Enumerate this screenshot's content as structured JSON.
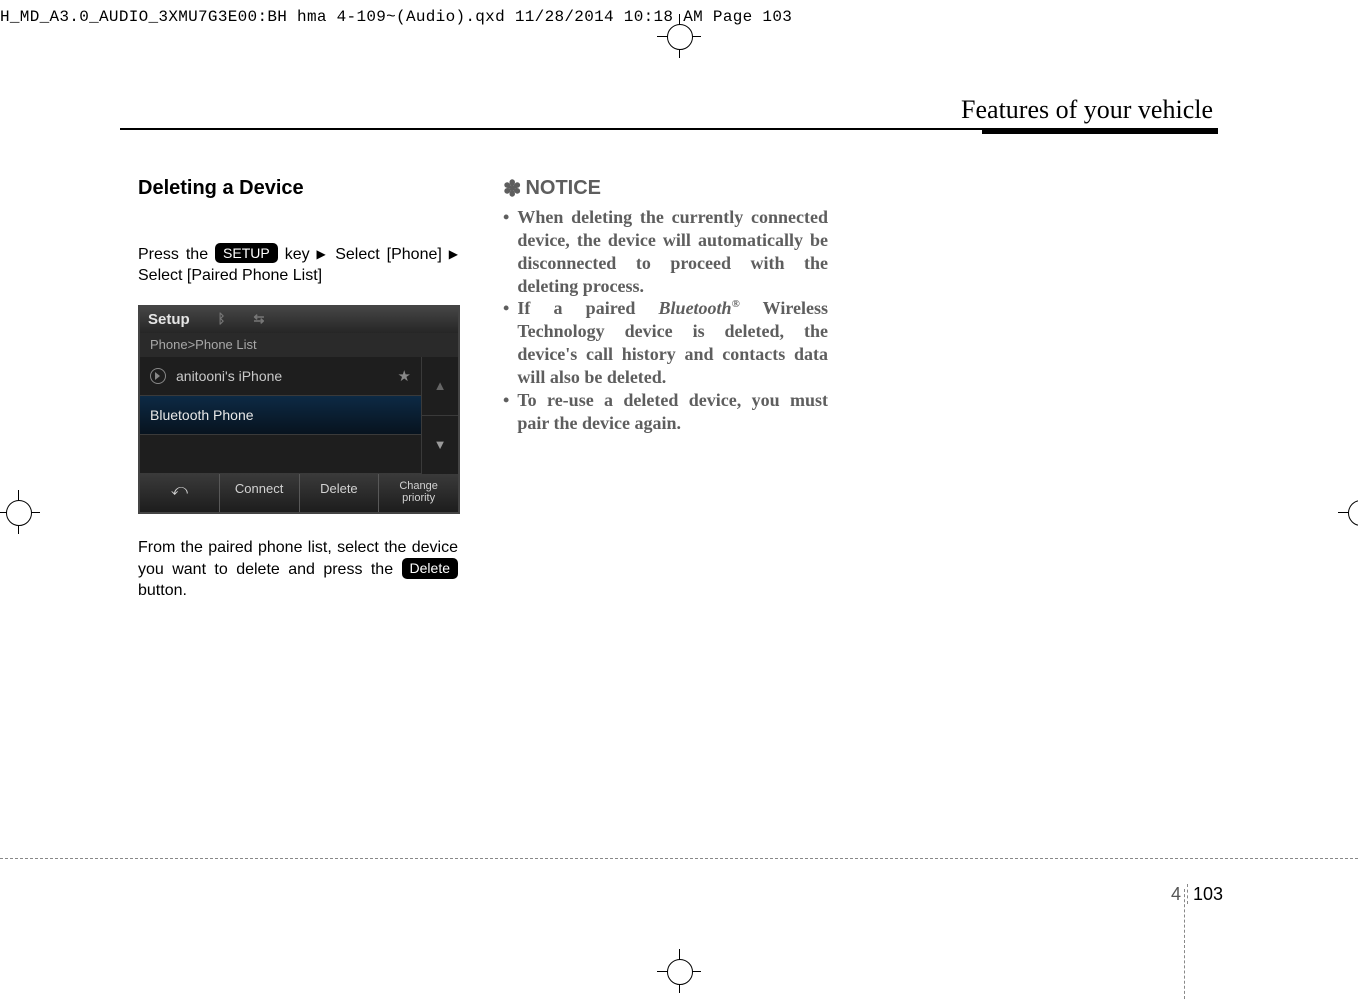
{
  "header_file_line": "H_MD_A3.0_AUDIO_3XMU7G3E00:BH hma 4-109~(Audio).qxd  11/28/2014  10:18 AM  Page 103",
  "running_head": "Features of your vehicle",
  "left": {
    "title": "Deleting a Device",
    "p1_a": "Press  the ",
    "setup_chip": "SETUP",
    "p1_b": " key",
    "p1_c": "Select [Phone] ",
    "p1_d": "Select [Paired Phone List]",
    "p2_a": "From the paired phone list, select the device you want to delete and press the ",
    "delete_chip": "Delete",
    "p2_b": " button."
  },
  "shot": {
    "bar_title": "Setup",
    "crumb": "Phone>Phone List",
    "row1": "anitooni's iPhone",
    "row2": "Bluetooth Phone",
    "footer_connect": "Connect",
    "footer_delete": "Delete",
    "footer_change1": "Change",
    "footer_change2": "priority"
  },
  "notice": {
    "title": "NOTICE",
    "item1": "When deleting the currently connected device, the device will automatically be disconnected to proceed with the deleting process.",
    "item2_a": "If a paired ",
    "item2_bt": "Bluetooth",
    "item2_b": "  Wireless Technology device is deleted, the device's call history and contacts data will also be deleted.",
    "item3": "To re-use a deleted device, you must pair the device again."
  },
  "page": {
    "section": "4",
    "number": "103"
  }
}
